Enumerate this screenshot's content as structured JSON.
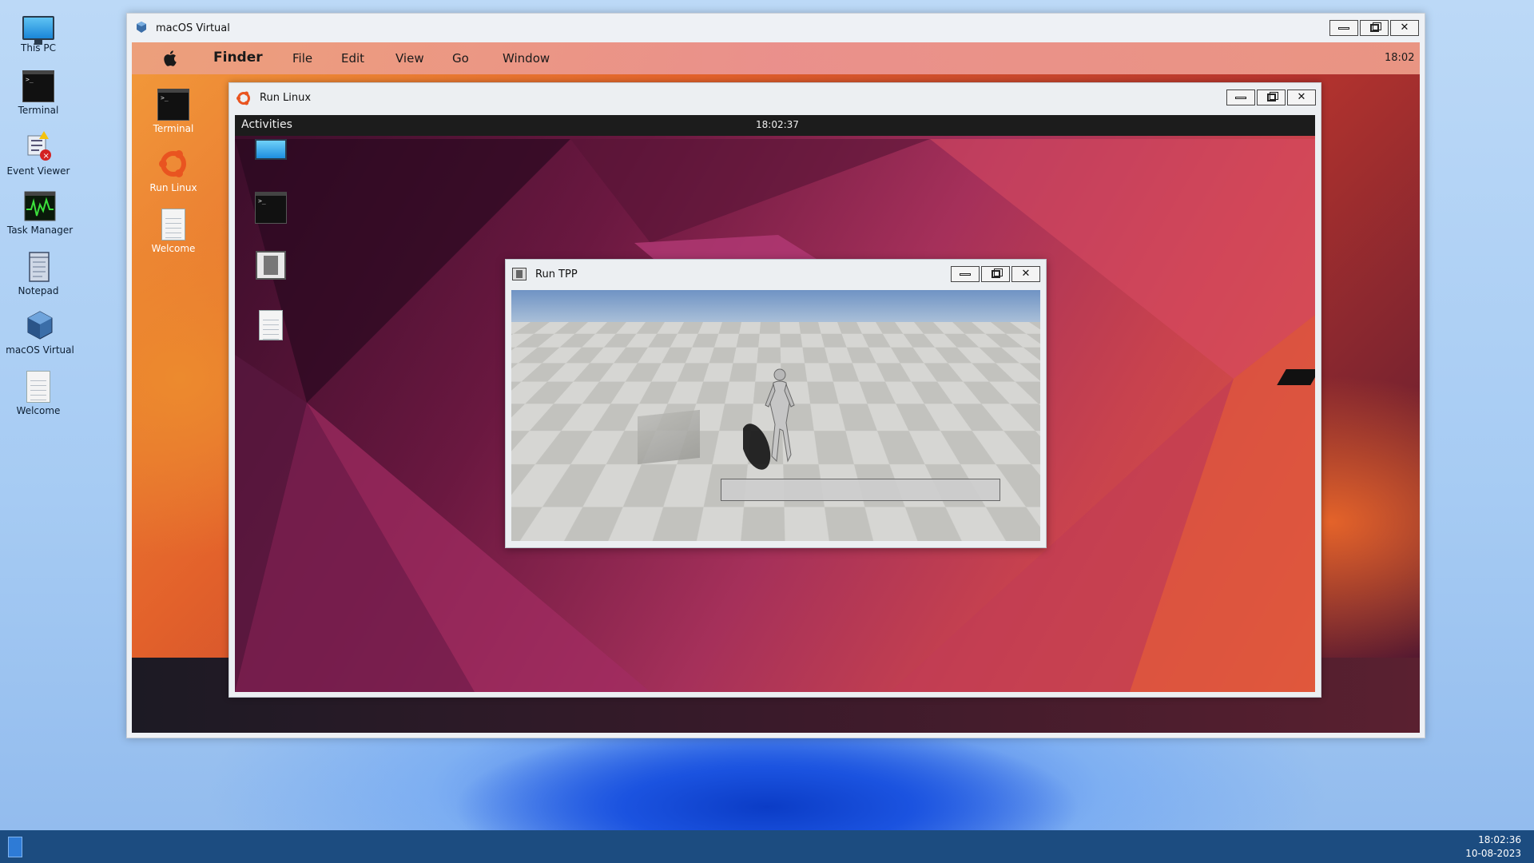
{
  "desktop": {
    "icons": [
      {
        "label": "This PC",
        "icon": "computer-icon"
      },
      {
        "label": "Terminal",
        "icon": "terminal-icon"
      },
      {
        "label": "Event Viewer",
        "icon": "event-viewer-icon"
      },
      {
        "label": "Task Manager",
        "icon": "task-manager-icon"
      },
      {
        "label": "Notepad",
        "icon": "notepad-icon"
      },
      {
        "label": "macOS Virtual",
        "icon": "virtualbox-icon"
      },
      {
        "label": "Welcome",
        "icon": "document-icon"
      }
    ]
  },
  "vm_window": {
    "title": "macOS Virtual",
    "controls": {
      "minimize": "minimize",
      "maximize": "maximize",
      "close": "close"
    }
  },
  "mac": {
    "menubar": {
      "app": "Finder",
      "items": [
        "File",
        "Edit",
        "View",
        "Go",
        "Window"
      ],
      "clock": "18:02"
    },
    "desktop_icons": [
      {
        "label": "Terminal",
        "icon": "terminal-icon"
      },
      {
        "label": "Run Linux",
        "icon": "ubuntu-icon"
      },
      {
        "label": "Welcome",
        "icon": "document-icon"
      }
    ]
  },
  "linux_window": {
    "title": "Run Linux",
    "topbar": {
      "activities": "Activities",
      "clock": "18:02:37"
    },
    "desktop_icons": [
      {
        "label": "",
        "icon": "monitor-icon"
      },
      {
        "label": "",
        "icon": "terminal-icon"
      },
      {
        "label": "",
        "icon": "film-icon"
      },
      {
        "label": "",
        "icon": "document-icon"
      }
    ]
  },
  "tpp_window": {
    "title": "Run TPP"
  },
  "taskbar": {
    "time": "18:02:36",
    "date": "10-08-2023"
  },
  "colors": {
    "taskbar": "#1c4c80",
    "ubuntu_orange": "#e95420",
    "gnome_bar": "#1c1c1c"
  }
}
